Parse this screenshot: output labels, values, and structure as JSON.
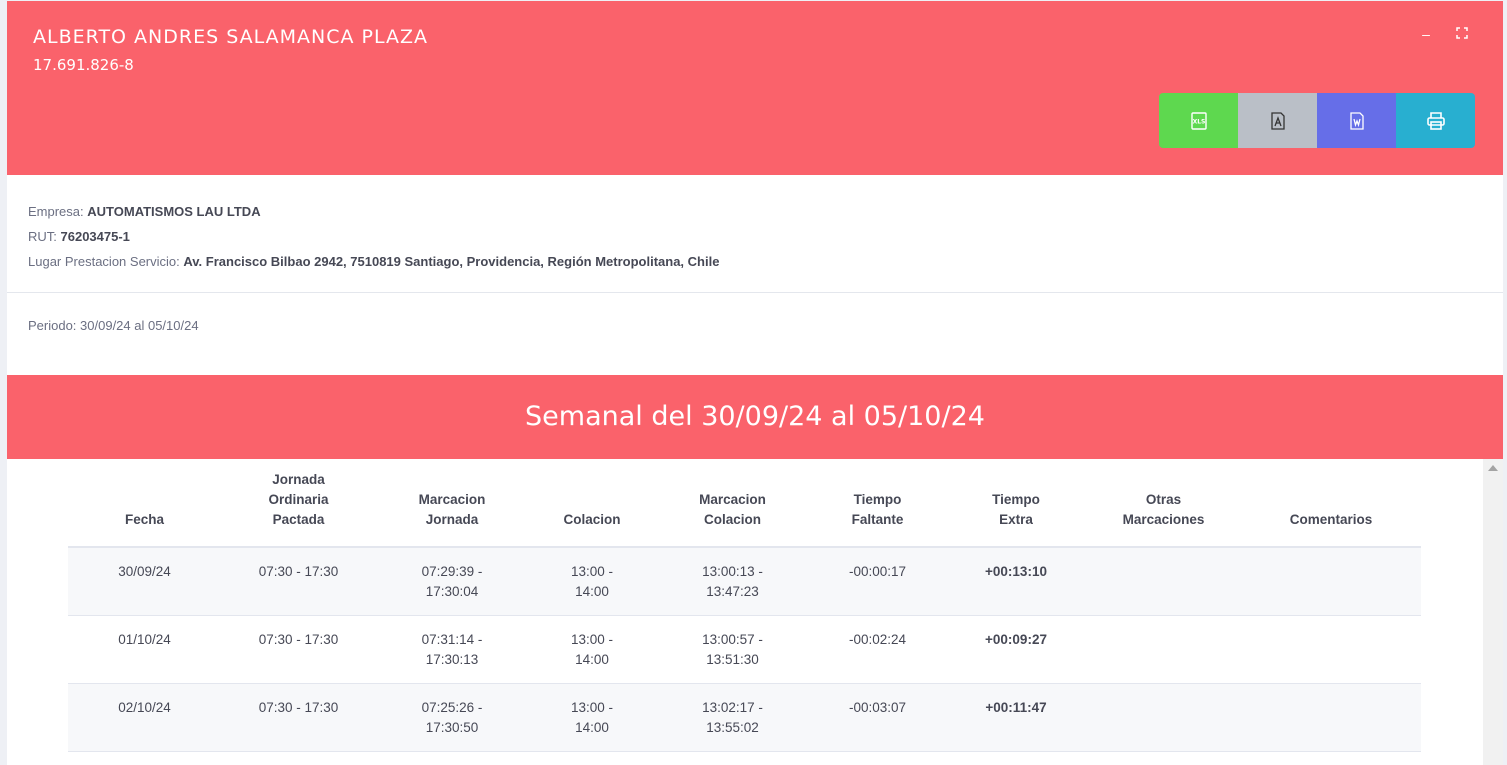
{
  "header": {
    "name": "ALBERTO ANDRES SALAMANCA PLAZA",
    "rut": "17.691.826-8",
    "buttons": [
      {
        "name": "excel",
        "icon": "xls-icon",
        "color": "#5ed84f"
      },
      {
        "name": "pdf",
        "icon": "pdf-icon",
        "color": "#babfc7"
      },
      {
        "name": "word",
        "icon": "word-icon",
        "color": "#666ee8"
      },
      {
        "name": "print",
        "icon": "printer-icon",
        "color": "#28afd0"
      }
    ]
  },
  "info": {
    "empresa_label": "Empresa:",
    "empresa_value": "AUTOMATISMOS LAU LTDA",
    "rut_label": "RUT:",
    "rut_value": "76203475-1",
    "lugar_label": "Lugar Prestacion Servicio:",
    "lugar_value": "Av. Francisco Bilbao 2942, 7510819 Santiago, Providencia, Región Metropolitana, Chile"
  },
  "periodo": "Periodo: 30/09/24 al 05/10/24",
  "band_title": "Semanal del 30/09/24 al 05/10/24",
  "colors": {
    "accent": "#fa626b"
  },
  "table": {
    "headers": [
      "Fecha",
      "Jornada Ordinaria Pactada",
      "Marcacion Jornada",
      "Colacion",
      "Marcacion Colacion",
      "Tiempo Faltante",
      "Tiempo Extra",
      "Otras Marcaciones",
      "Comentarios"
    ],
    "rows": [
      [
        "30/09/24",
        "07:30 - 17:30",
        "07:29:39 - 17:30:04",
        "13:00 - 14:00",
        "13:00:13 - 13:47:23",
        "-00:00:17",
        "+00:13:10",
        "",
        ""
      ],
      [
        "01/10/24",
        "07:30 - 17:30",
        "07:31:14 - 17:30:13",
        "13:00 - 14:00",
        "13:00:57 - 13:51:30",
        "-00:02:24",
        "+00:09:27",
        "",
        ""
      ],
      [
        "02/10/24",
        "07:30 - 17:30",
        "07:25:26 - 17:30:50",
        "13:00 - 14:00",
        "13:02:17 - 13:55:02",
        "-00:03:07",
        "+00:11:47",
        "",
        ""
      ]
    ]
  }
}
